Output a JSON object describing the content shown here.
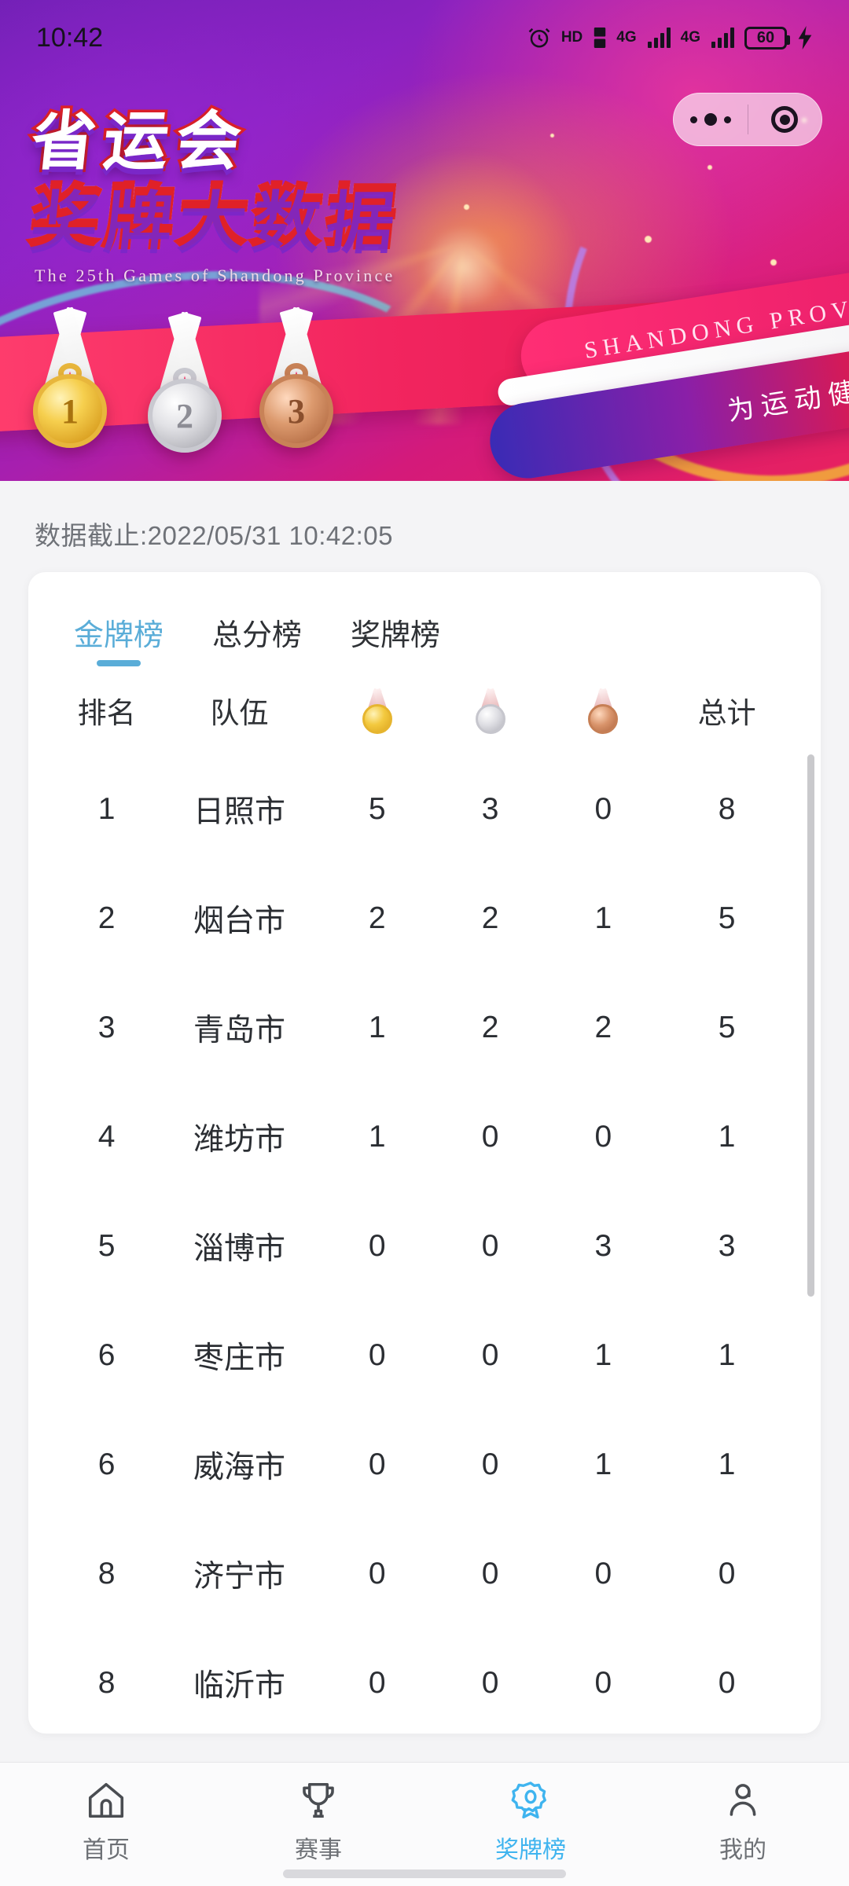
{
  "status_bar": {
    "time": "10:42",
    "alarm_icon": "alarm-clock-icon",
    "hd_label": "HD",
    "sim1_net": "4G",
    "sim2_net": "4G",
    "battery_level": "60",
    "charging_icon": "charging-bolt-icon"
  },
  "capsule": {
    "more_icon": "more-dots-icon",
    "close_icon": "target-circle-icon"
  },
  "banner": {
    "title_cn_line1": "省运会",
    "title_cn_line2": "奖牌大数据",
    "title_en": "The 25th Games of Shandong Province",
    "ribbon_en": "SHANDONG PROVINCE",
    "ribbon_cn": "为运动健儿加油",
    "medals": [
      {
        "place": "1",
        "name": "gold-medal-icon"
      },
      {
        "place": "2",
        "name": "silver-medal-icon"
      },
      {
        "place": "3",
        "name": "bronze-medal-icon"
      }
    ]
  },
  "timestamp": "数据截止:2022/05/31 10:42:05",
  "colors": {
    "accent": "#5aadd8",
    "nav_active": "#3fb4ef",
    "gold": "#f3c93f",
    "silver": "#dfdfe4",
    "bronze": "#d8936a"
  },
  "tabs": [
    {
      "label": "金牌榜",
      "active": true
    },
    {
      "label": "总分榜",
      "active": false
    },
    {
      "label": "奖牌榜",
      "active": false
    }
  ],
  "table": {
    "headers": {
      "rank": "排名",
      "team": "队伍",
      "gold": "gold-medal-icon",
      "silver": "silver-medal-icon",
      "bronze": "bronze-medal-icon",
      "total": "总计"
    },
    "rows": [
      {
        "rank": "1",
        "team": "日照市",
        "gold": "5",
        "silver": "3",
        "bronze": "0",
        "total": "8"
      },
      {
        "rank": "2",
        "team": "烟台市",
        "gold": "2",
        "silver": "2",
        "bronze": "1",
        "total": "5"
      },
      {
        "rank": "3",
        "team": "青岛市",
        "gold": "1",
        "silver": "2",
        "bronze": "2",
        "total": "5"
      },
      {
        "rank": "4",
        "team": "潍坊市",
        "gold": "1",
        "silver": "0",
        "bronze": "0",
        "total": "1"
      },
      {
        "rank": "5",
        "team": "淄博市",
        "gold": "0",
        "silver": "0",
        "bronze": "3",
        "total": "3"
      },
      {
        "rank": "6",
        "team": "枣庄市",
        "gold": "0",
        "silver": "0",
        "bronze": "1",
        "total": "1"
      },
      {
        "rank": "6",
        "team": "威海市",
        "gold": "0",
        "silver": "0",
        "bronze": "1",
        "total": "1"
      },
      {
        "rank": "8",
        "team": "济宁市",
        "gold": "0",
        "silver": "0",
        "bronze": "0",
        "total": "0"
      },
      {
        "rank": "8",
        "team": "临沂市",
        "gold": "0",
        "silver": "0",
        "bronze": "0",
        "total": "0"
      }
    ]
  },
  "bottom_nav": [
    {
      "label": "首页",
      "icon": "home-icon",
      "active": false
    },
    {
      "label": "赛事",
      "icon": "trophy-icon",
      "active": false
    },
    {
      "label": "奖牌榜",
      "icon": "medal-rosette-icon",
      "active": true
    },
    {
      "label": "我的",
      "icon": "person-icon",
      "active": false
    }
  ]
}
